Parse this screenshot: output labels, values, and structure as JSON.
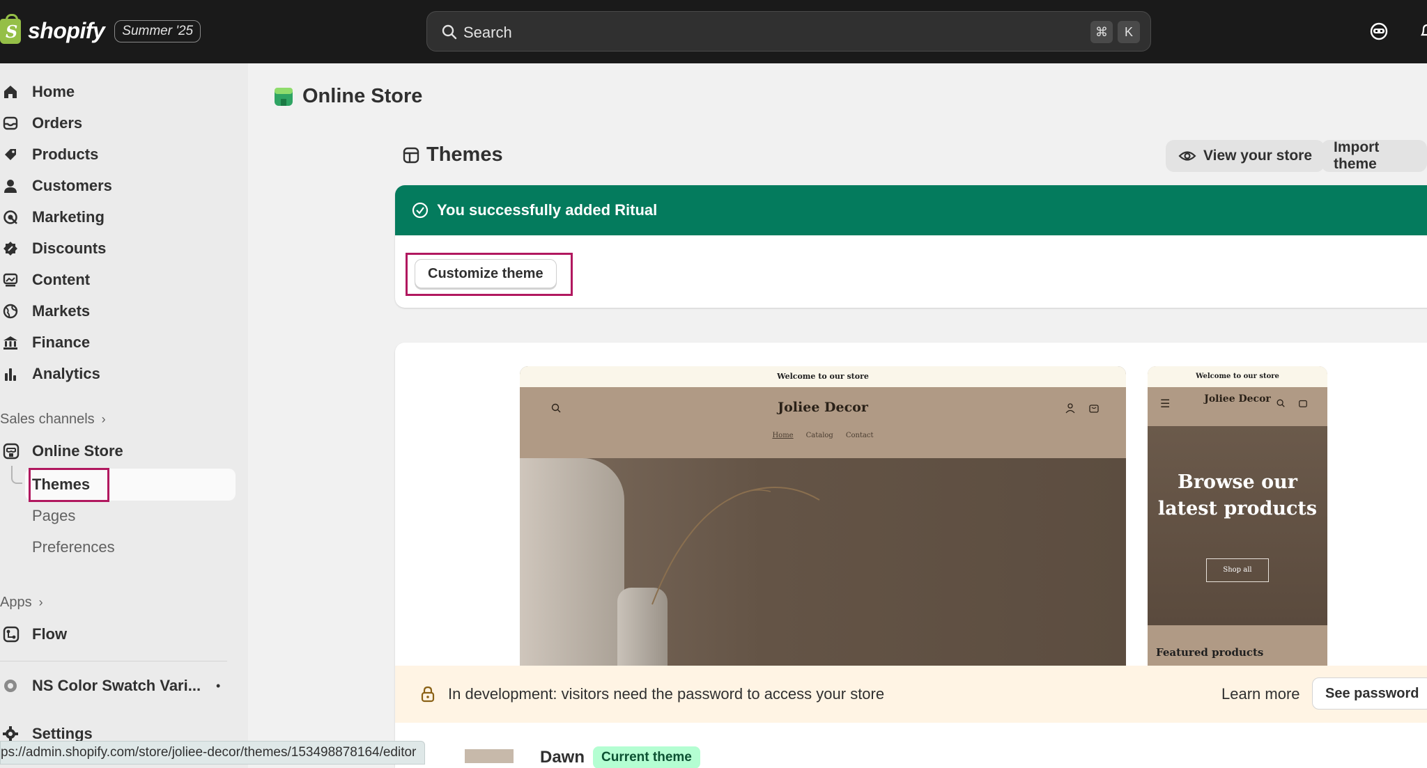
{
  "topbar": {
    "logo_text": "shopify",
    "edition": "Summer '25",
    "search_placeholder": "Search",
    "shortcut_cmd": "⌘",
    "shortcut_key": "K"
  },
  "sidebar": {
    "items": [
      {
        "label": "Home",
        "icon": "home-icon"
      },
      {
        "label": "Orders",
        "icon": "orders-icon"
      },
      {
        "label": "Products",
        "icon": "products-icon"
      },
      {
        "label": "Customers",
        "icon": "customers-icon"
      },
      {
        "label": "Marketing",
        "icon": "marketing-icon"
      },
      {
        "label": "Discounts",
        "icon": "discounts-icon"
      },
      {
        "label": "Content",
        "icon": "content-icon"
      },
      {
        "label": "Markets",
        "icon": "markets-icon"
      },
      {
        "label": "Finance",
        "icon": "finance-icon"
      },
      {
        "label": "Analytics",
        "icon": "analytics-icon"
      }
    ],
    "sales_channels_label": "Sales channels",
    "online_store_label": "Online Store",
    "sub_items": [
      "Themes",
      "Pages",
      "Preferences"
    ],
    "apps_label": "Apps",
    "flow_label": "Flow",
    "app_label": "NS Color Swatch Vari...",
    "settings_label": "Settings"
  },
  "main": {
    "page_title": "Online Store",
    "section_title": "Themes",
    "view_store_label": "View your store",
    "import_theme_label": "Import theme",
    "banner_text": "You successfully added Ritual",
    "customize_label": "Customize theme",
    "preview": {
      "strip_text": "Welcome to our store",
      "brand": "Joliee Decor",
      "nav": [
        "Home",
        "Catalog",
        "Contact"
      ],
      "mobile_heading": "Browse our latest products",
      "mobile_button": "Shop all",
      "mobile_featured": "Featured products"
    },
    "dev_text": "In development: visitors need the password to access your store",
    "learn_more": "Learn more",
    "see_password": "See password",
    "theme_name": "Dawn",
    "current_badge": "Current theme"
  },
  "status_url": "ps://admin.shopify.com/store/joliee-decor/themes/153498878164/editor",
  "colors": {
    "topbar": "#1a1a1a",
    "success_banner": "#047b5d",
    "highlight": "#b1185f",
    "dev_bar": "#fff4e4",
    "badge": "#b4fed2"
  }
}
